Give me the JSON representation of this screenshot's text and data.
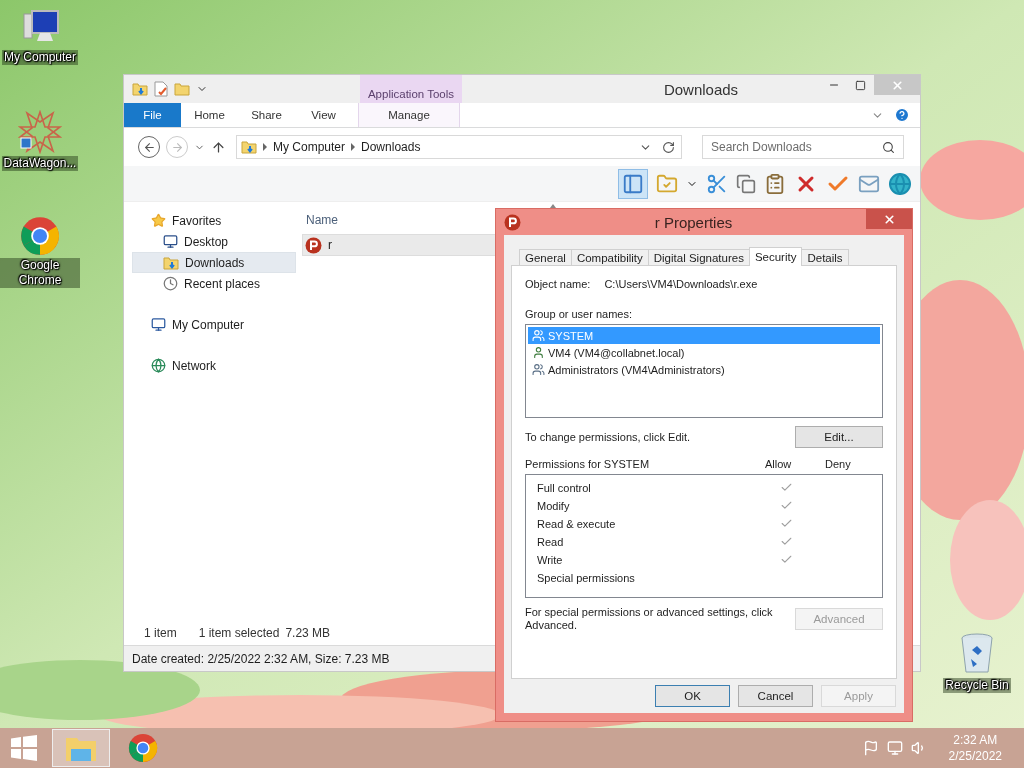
{
  "desktop_icons": [
    {
      "label": "My Computer",
      "kind": "computer"
    },
    {
      "label": "DataWagon...",
      "kind": "star"
    },
    {
      "label": "Google Chrome",
      "kind": "chrome"
    },
    {
      "label": "Recycle Bin",
      "kind": "bin"
    }
  ],
  "explorer": {
    "title": "Downloads",
    "context_tab_group": "Application Tools",
    "ribbon_tabs": [
      {
        "label": "File",
        "kind": "file",
        "selected": false
      },
      {
        "label": "Home",
        "kind": "tab",
        "selected": false
      },
      {
        "label": "Share",
        "kind": "tab",
        "selected": false
      },
      {
        "label": "View",
        "kind": "tab",
        "selected": false
      },
      {
        "label": "Manage",
        "kind": "context",
        "selected": false
      }
    ],
    "path": [
      "My Computer",
      "Downloads"
    ],
    "search": {
      "placeholder": "Search Downloads"
    },
    "nav": [
      {
        "label": "Favorites",
        "kind": "star",
        "selected": false,
        "children": [
          {
            "label": "Desktop",
            "kind": "desktop",
            "selected": false
          },
          {
            "label": "Downloads",
            "kind": "downloads",
            "selected": true
          },
          {
            "label": "Recent places",
            "kind": "recent",
            "selected": false
          }
        ]
      },
      {
        "label": "My Computer",
        "kind": "computer",
        "selected": false
      },
      {
        "label": "Network",
        "kind": "network",
        "selected": false
      }
    ],
    "columns": [
      "Name"
    ],
    "files": [
      {
        "name": "r",
        "selected": true
      }
    ],
    "status": [
      "1 item",
      "1 item selected",
      "7.23 MB"
    ],
    "details": "Date created: 2/25/2022 2:32 AM, Size: 7.23 MB"
  },
  "dialog": {
    "title": "r Properties",
    "tabs": [
      {
        "label": "General",
        "selected": false
      },
      {
        "label": "Compatibility",
        "selected": false
      },
      {
        "label": "Digital Signatures",
        "selected": false
      },
      {
        "label": "Security",
        "selected": true
      },
      {
        "label": "Details",
        "selected": false
      }
    ],
    "object_label": "Object name:",
    "object_value": "C:\\Users\\VM4\\Downloads\\r.exe",
    "group_label": "Group or user names:",
    "users": [
      {
        "name": "SYSTEM",
        "kind": "group",
        "selected": true
      },
      {
        "name": "VM4 (VM4@collabnet.local)",
        "kind": "user",
        "selected": false
      },
      {
        "name": "Administrators (VM4\\Administrators)",
        "kind": "group",
        "selected": false
      }
    ],
    "change_note": "To change permissions, click Edit.",
    "edit_button": "Edit...",
    "permissions_label": "Permissions for SYSTEM",
    "allow_label": "Allow",
    "deny_label": "Deny",
    "permissions": [
      {
        "name": "Full control",
        "allow": true
      },
      {
        "name": "Modify",
        "allow": true
      },
      {
        "name": "Read & execute",
        "allow": true
      },
      {
        "name": "Read",
        "allow": true
      },
      {
        "name": "Write",
        "allow": true
      },
      {
        "name": "Special permissions",
        "allow": false
      }
    ],
    "advanced_note": "For special permissions or advanced settings, click Advanced.",
    "advanced_button": {
      "label": "Advanced",
      "disabled": true
    },
    "buttons": [
      {
        "label": "OK",
        "disabled": false,
        "selected": true
      },
      {
        "label": "Cancel",
        "disabled": false,
        "selected": false
      },
      {
        "label": "Apply",
        "disabled": true,
        "selected": false
      }
    ]
  },
  "taskbar": {
    "apps": [
      {
        "kind": "explorer",
        "selected": true
      },
      {
        "kind": "chrome",
        "selected": false
      }
    ],
    "time": "2:32 AM",
    "date": "2/25/2022"
  }
}
